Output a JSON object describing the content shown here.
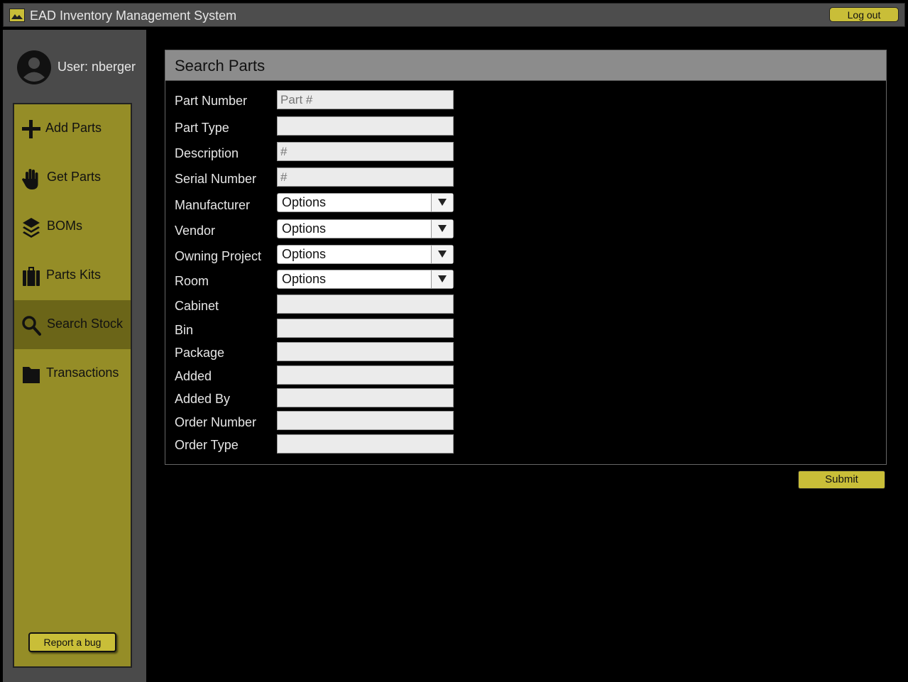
{
  "window": {
    "title": "EAD Inventory Management System",
    "icon": "image-icon"
  },
  "header": {
    "logout_label": "Log out"
  },
  "user": {
    "label": "User: nberger",
    "icon": "user-avatar-icon"
  },
  "nav": {
    "items": [
      {
        "label": "Add Parts",
        "icon": "plus-icon"
      },
      {
        "label": "Get Parts",
        "icon": "hand-icon"
      },
      {
        "label": "BOMs",
        "icon": "layers-icon"
      },
      {
        "label": "Parts Kits",
        "icon": "luggage-icon"
      },
      {
        "label": "Search Stock",
        "icon": "search-icon",
        "active": true
      },
      {
        "label": "Transactions",
        "icon": "folder-icon"
      }
    ],
    "report_bug_label": "Report a bug"
  },
  "panel": {
    "title": "Search Parts",
    "fields": [
      {
        "label": "Part Number",
        "type": "text",
        "value": "",
        "placeholder": "Part #"
      },
      {
        "label": "Part Type",
        "type": "text",
        "value": "",
        "placeholder": ""
      },
      {
        "label": "Description",
        "type": "text",
        "value": "",
        "placeholder": "#"
      },
      {
        "label": "Serial Number",
        "type": "text",
        "value": "",
        "placeholder": "#"
      },
      {
        "label": "Manufacturer",
        "type": "select",
        "value": "Options"
      },
      {
        "label": "Vendor",
        "type": "select",
        "value": "Options"
      },
      {
        "label": "Owning Project",
        "type": "select",
        "value": "Options"
      },
      {
        "label": "Room",
        "type": "select",
        "value": "Options"
      },
      {
        "label": "Cabinet",
        "type": "text",
        "value": "",
        "placeholder": ""
      },
      {
        "label": "Bin",
        "type": "text",
        "value": "",
        "placeholder": ""
      },
      {
        "label": "Package",
        "type": "text",
        "value": "",
        "placeholder": ""
      },
      {
        "label": "Added",
        "type": "text",
        "value": "",
        "placeholder": ""
      },
      {
        "label": "Added By",
        "type": "text",
        "value": "",
        "placeholder": ""
      },
      {
        "label": "Order Number",
        "type": "text",
        "value": "",
        "placeholder": ""
      },
      {
        "label": "Order Type",
        "type": "text",
        "value": "",
        "placeholder": ""
      }
    ],
    "submit_label": "Submit"
  },
  "colors": {
    "accent": "#c9be38",
    "nav_bg": "#958d27",
    "nav_active": "#6b6518",
    "header_bg": "#8c8c8c"
  }
}
